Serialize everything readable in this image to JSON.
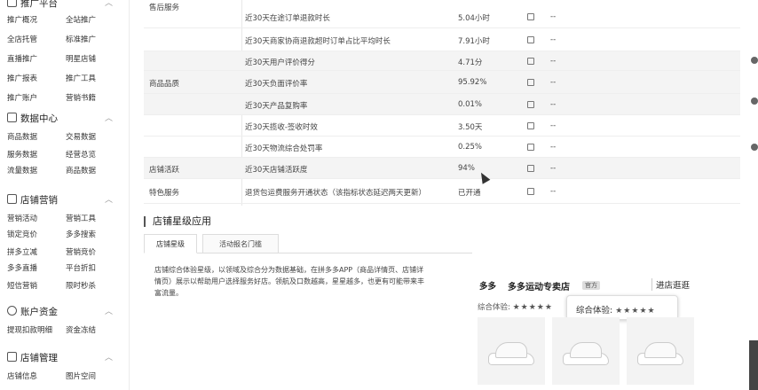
{
  "sidebar": {
    "sections": [
      {
        "title": "推广平台",
        "items": [
          "推广概况",
          "全站推广",
          "全店托管",
          "标准推广",
          "直播推广",
          "明星店铺",
          "推广报表",
          "推广工具",
          "推广账户",
          "营销书籍"
        ]
      },
      {
        "title": "数据中心",
        "items": [
          "商品数据",
          "交易数据",
          "服务数据",
          "经营总览",
          "流量数据",
          "商品数据"
        ]
      },
      {
        "title": "店铺营销",
        "items": [
          "营销活动",
          "营销工具",
          "锁定竞价",
          "多多搜索",
          "拼多立减",
          "营销竞价",
          "多多直播",
          "平台折扣",
          "短信营销",
          "限时秒杀"
        ]
      },
      {
        "title": "账户资金",
        "items": [
          "提现扣款明细",
          "资金冻结"
        ]
      },
      {
        "title": "店铺管理",
        "items": [
          "店铺信息",
          "图片空间"
        ]
      }
    ]
  },
  "table": {
    "rows": [
      {
        "category": "售后服务",
        "name": "近30天在途订单退款时长",
        "value": "5.04小时",
        "dash": "--"
      },
      {
        "category": "",
        "name": "近30天商家协商退款超时订单占比平均时长",
        "value": "7.91小时",
        "dash": "--"
      },
      {
        "category": "",
        "name": "近30天用户评价得分",
        "value": "4.71分",
        "dash": "--"
      },
      {
        "category": "商品品质",
        "name": "近30天负面评价率",
        "value": "95.92%",
        "dash": "--"
      },
      {
        "category": "",
        "name": "近30天产品复购率",
        "value": "0.01%",
        "dash": "--"
      },
      {
        "category": "物流服务",
        "name": "近30天揽收-签收时效",
        "value": "3.50天",
        "dash": "--"
      },
      {
        "category": "",
        "name": "近30天物流综合处罚率",
        "value": "0.25%",
        "dash": "--"
      },
      {
        "category": "店铺活跃",
        "name": "近30天店铺活跃度",
        "value": "94%",
        "dash": "--"
      },
      {
        "category": "特色服务",
        "name": "退货包运费服务开通状态（该指标状态延迟两天更新）",
        "value": "已开通",
        "dash": "--"
      }
    ]
  },
  "section": {
    "title": "店铺星级应用",
    "tab_active": "店铺星级",
    "tab_other": "活动报名门槛",
    "description": "店铺综合体验星级，以领域及综合分为数据基础，在拼多多APP（商品详情页、店铺详情页）展示以帮助用户选择服务好店。领航及口数越高，星星越多，也更有可能带来丰富流量。"
  },
  "preview": {
    "brand": "多多",
    "store_name": "多多运动专卖店",
    "badge": "官方",
    "visit": "进店逛逛",
    "rating_label": "综合体验:",
    "tooltip": "综合体验:",
    "stars": "★★★★★"
  }
}
